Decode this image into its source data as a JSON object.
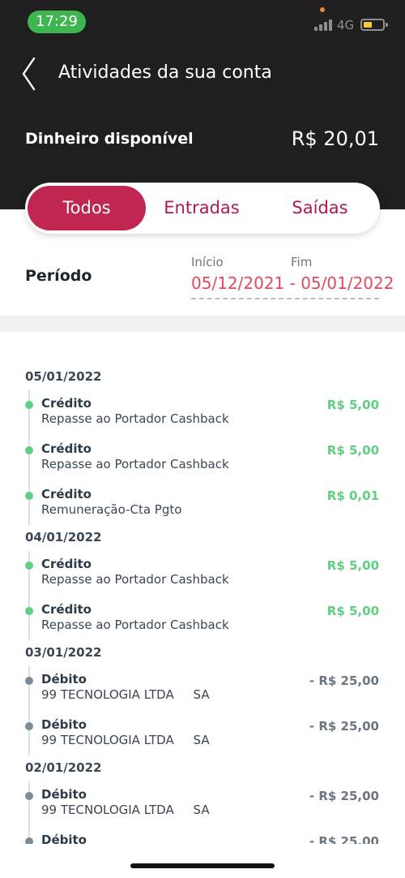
{
  "status": {
    "time": "17:29",
    "network": "4G"
  },
  "header": {
    "title": "Atividades da sua conta"
  },
  "balance": {
    "label": "Dinheiro disponível",
    "value": "R$ 20,01"
  },
  "tabs": [
    {
      "label": "Todos"
    },
    {
      "label": "Entradas"
    },
    {
      "label": "Saídas"
    }
  ],
  "period": {
    "label": "Período",
    "start_label": "Início",
    "end_label": "Fim",
    "range": "05/12/2021 - 05/01/2022"
  },
  "timeline": [
    {
      "date": "05/01/2022"
    },
    {
      "title": "Crédito",
      "desc": "Repasse ao Portador Cashback",
      "amount": "R$ 5,00",
      "kind": "credit"
    },
    {
      "title": "Crédito",
      "desc": "Repasse ao Portador Cashback",
      "amount": "R$ 5,00",
      "kind": "credit"
    },
    {
      "title": "Crédito",
      "desc": "Remuneração-Cta Pgto",
      "amount": "R$ 0,01",
      "kind": "credit"
    },
    {
      "date": "04/01/2022"
    },
    {
      "title": "Crédito",
      "desc": "Repasse ao Portador Cashback",
      "amount": "R$ 5,00",
      "kind": "credit"
    },
    {
      "title": "Crédito",
      "desc": "Repasse ao Portador Cashback",
      "amount": "R$ 5,00",
      "kind": "credit"
    },
    {
      "date": "03/01/2022"
    },
    {
      "title": "Débito",
      "desc": "99 TECNOLOGIA LTDA     SA",
      "amount": "- R$ 25,00",
      "kind": "debit"
    },
    {
      "title": "Débito",
      "desc": "99 TECNOLOGIA LTDA     SA",
      "amount": "- R$ 25,00",
      "kind": "debit"
    },
    {
      "date": "02/01/2022"
    },
    {
      "title": "Débito",
      "desc": "99 TECNOLOGIA LTDA     SA",
      "amount": "- R$ 25,00",
      "kind": "debit"
    },
    {
      "title": "Débito",
      "desc": "",
      "amount": "- R$ 25,00",
      "kind": "debit"
    }
  ]
}
